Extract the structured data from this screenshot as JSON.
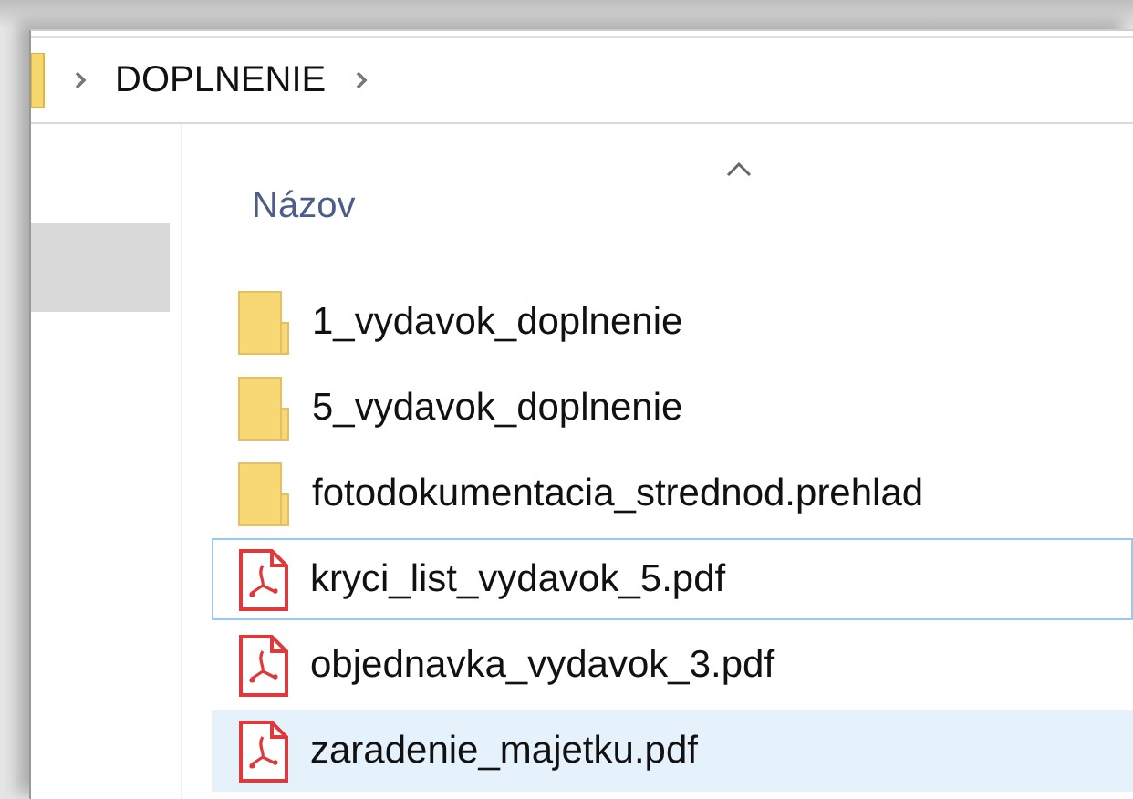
{
  "address_bar": {
    "path": [
      {
        "label": "DOPLNENIE"
      }
    ]
  },
  "navigation_pane": {
    "items": [
      {
        "selected": true
      }
    ]
  },
  "file_list": {
    "columns": [
      {
        "label": "Názov",
        "sorted": true
      }
    ],
    "rows": [
      {
        "kind": "folder",
        "name": "1_vydavok_doplnenie",
        "selected": false,
        "focused": false
      },
      {
        "kind": "folder",
        "name": "5_vydavok_doplnenie",
        "selected": false,
        "focused": false
      },
      {
        "kind": "folder",
        "name": "fotodokumentacia_strednod.prehlad",
        "selected": false,
        "focused": false
      },
      {
        "kind": "pdf",
        "name": "kryci_list_vydavok_5.pdf",
        "selected": false,
        "focused": true
      },
      {
        "kind": "pdf",
        "name": "objednavka_vydavok_3.pdf",
        "selected": false,
        "focused": false
      },
      {
        "kind": "pdf",
        "name": "zaradenie_majetku.pdf",
        "selected": true,
        "focused": false
      }
    ]
  }
}
